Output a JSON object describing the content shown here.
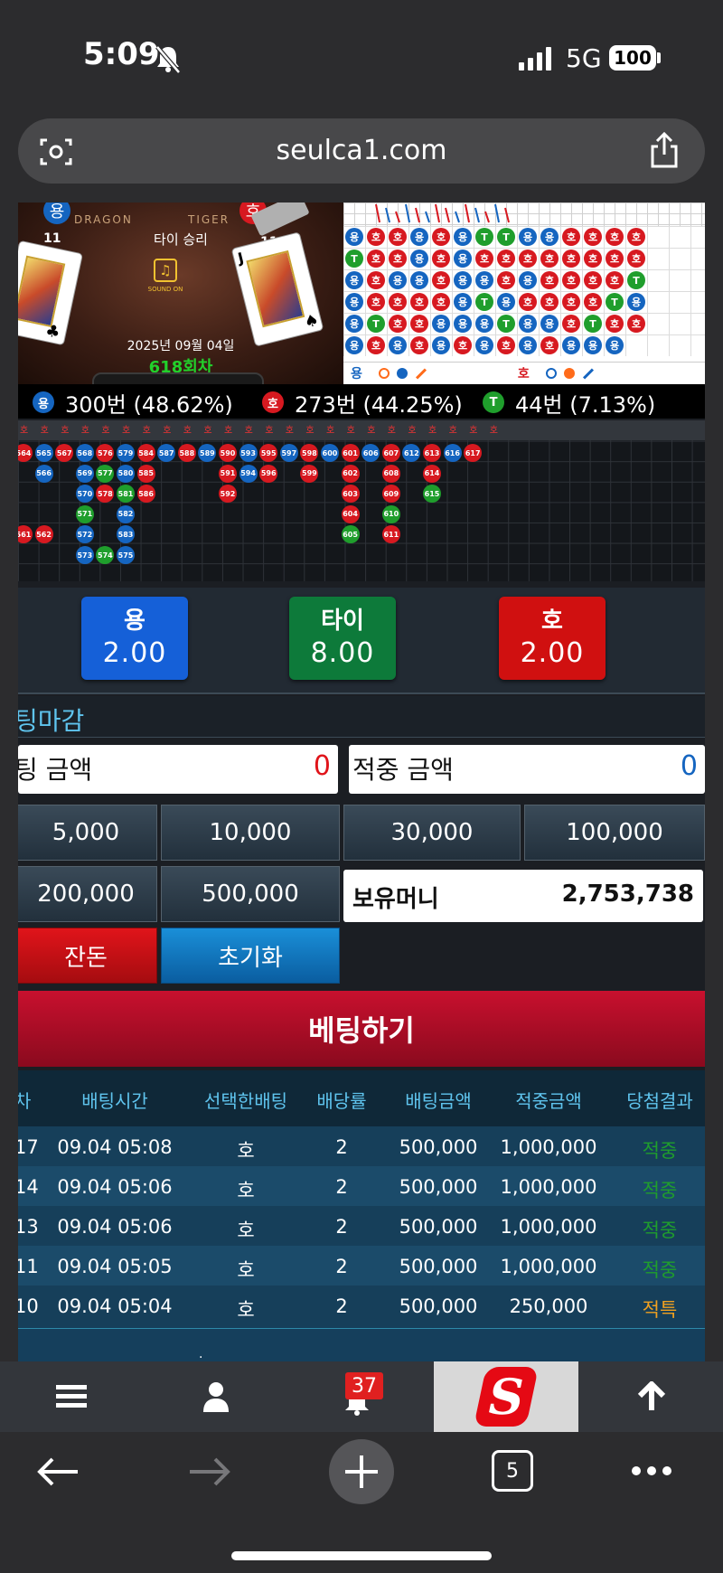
{
  "status_bar": {
    "time": "5:09",
    "network": "5G",
    "battery": "100"
  },
  "url_bar": {
    "domain": "seulca1.com"
  },
  "game": {
    "dragon_label": "DRAGON",
    "tiger_label": "TIGER",
    "dragon_short": "용",
    "tiger_short": "호",
    "result_text": "타이 승리",
    "left_card_value": "11",
    "right_card_value": "11",
    "sound_label": "SOUND ON",
    "date_text": "2025년 09월 04일",
    "round_text": "618회차"
  },
  "road_grid": {
    "rows": [
      [
        "용",
        "호",
        "호",
        "용",
        "호",
        "용",
        "T",
        "T",
        "용",
        "용",
        "호",
        "호",
        "호",
        "호"
      ],
      [
        "T",
        "호",
        "호",
        "용",
        "호",
        "용",
        "호",
        "호",
        "호",
        "호",
        "호",
        "호",
        "호",
        "호"
      ],
      [
        "용",
        "호",
        "용",
        "용",
        "호",
        "용",
        "용",
        "호",
        "용",
        "호",
        "호",
        "호",
        "호",
        "T"
      ],
      [
        "용",
        "호",
        "호",
        "호",
        "호",
        "용",
        "T",
        "용",
        "호",
        "호",
        "호",
        "호",
        "T",
        "용"
      ],
      [
        "용",
        "T",
        "호",
        "호",
        "용",
        "용",
        "용",
        "T",
        "용",
        "용",
        "호",
        "T",
        "호",
        "호"
      ],
      [
        "용",
        "호",
        "용",
        "호",
        "용",
        "호",
        "용",
        "호",
        "용",
        "호",
        "용",
        "용",
        "용",
        ""
      ]
    ],
    "legend_dragon": "용",
    "legend_tiger": "호"
  },
  "stats": {
    "dragon_icon": "용",
    "dragon_text": "300번 (48.62%)",
    "tiger_icon": "호",
    "tiger_text": "273번 (44.25%)",
    "tie_icon": "T",
    "tie_text": "44번 (7.13%)"
  },
  "round_history": {
    "header": [
      "호",
      "호",
      "호",
      "호",
      "호",
      "호",
      "호",
      "호",
      "호",
      "호",
      "호",
      "호",
      "호",
      "호",
      "호",
      "호",
      "호",
      "호",
      "호",
      "호",
      "호",
      "호",
      "호",
      "호"
    ],
    "columns": [
      [
        {
          "n": "564",
          "c": "red"
        },
        {
          "n": "",
          "c": ""
        },
        {
          "n": "",
          "c": ""
        },
        {
          "n": "",
          "c": ""
        },
        {
          "n": "561",
          "c": "red"
        }
      ],
      [
        {
          "n": "565",
          "c": "blue"
        },
        {
          "n": "566",
          "c": "blue"
        },
        {
          "n": "",
          "c": ""
        },
        {
          "n": "",
          "c": ""
        },
        {
          "n": "562",
          "c": "red"
        }
      ],
      [
        {
          "n": "567",
          "c": "red"
        }
      ],
      [
        {
          "n": "568",
          "c": "blue"
        },
        {
          "n": "569",
          "c": "blue"
        },
        {
          "n": "570",
          "c": "blue"
        },
        {
          "n": "571",
          "c": "green"
        },
        {
          "n": "572",
          "c": "blue"
        },
        {
          "n": "573",
          "c": "blue"
        }
      ],
      [
        {
          "n": "576",
          "c": "red"
        },
        {
          "n": "577",
          "c": "green"
        },
        {
          "n": "578",
          "c": "red"
        },
        {
          "n": "",
          "c": ""
        },
        {
          "n": "",
          "c": ""
        },
        {
          "n": "574",
          "c": "green"
        }
      ],
      [
        {
          "n": "579",
          "c": "blue"
        },
        {
          "n": "580",
          "c": "blue"
        },
        {
          "n": "581",
          "c": "green"
        },
        {
          "n": "582",
          "c": "blue"
        },
        {
          "n": "583",
          "c": "blue"
        },
        {
          "n": "575",
          "c": "blue"
        }
      ],
      [
        {
          "n": "584",
          "c": "red"
        },
        {
          "n": "585",
          "c": "red"
        },
        {
          "n": "586",
          "c": "red"
        }
      ],
      [
        {
          "n": "587",
          "c": "blue"
        }
      ],
      [
        {
          "n": "588",
          "c": "red"
        }
      ],
      [
        {
          "n": "589",
          "c": "blue"
        }
      ],
      [
        {
          "n": "590",
          "c": "red"
        },
        {
          "n": "591",
          "c": "red"
        },
        {
          "n": "592",
          "c": "red"
        }
      ],
      [
        {
          "n": "593",
          "c": "blue"
        },
        {
          "n": "594",
          "c": "blue"
        }
      ],
      [
        {
          "n": "595",
          "c": "red"
        },
        {
          "n": "596",
          "c": "red"
        }
      ],
      [
        {
          "n": "597",
          "c": "blue"
        }
      ],
      [
        {
          "n": "598",
          "c": "red"
        },
        {
          "n": "599",
          "c": "red"
        }
      ],
      [
        {
          "n": "600",
          "c": "blue"
        }
      ],
      [
        {
          "n": "601",
          "c": "red"
        },
        {
          "n": "602",
          "c": "red"
        },
        {
          "n": "603",
          "c": "red"
        },
        {
          "n": "604",
          "c": "red"
        },
        {
          "n": "605",
          "c": "green"
        }
      ],
      [
        {
          "n": "606",
          "c": "blue"
        }
      ],
      [
        {
          "n": "607",
          "c": "red"
        },
        {
          "n": "608",
          "c": "red"
        },
        {
          "n": "609",
          "c": "red"
        },
        {
          "n": "610",
          "c": "green"
        },
        {
          "n": "611",
          "c": "red"
        }
      ],
      [
        {
          "n": "612",
          "c": "blue"
        }
      ],
      [
        {
          "n": "613",
          "c": "red"
        },
        {
          "n": "614",
          "c": "red"
        },
        {
          "n": "615",
          "c": "green"
        }
      ],
      [
        {
          "n": "616",
          "c": "blue"
        }
      ],
      [
        {
          "n": "617",
          "c": "red"
        }
      ]
    ]
  },
  "bet_buttons": [
    {
      "label": "용",
      "odds": "2.00",
      "color": "#1560d8"
    },
    {
      "label": "타이",
      "odds": "8.00",
      "color": "#0d7a3a"
    },
    {
      "label": "호",
      "odds": "2.00",
      "color": "#d01010"
    }
  ],
  "betting": {
    "closed_label": "팅마감",
    "bet_amount_label": "팅 금액",
    "bet_amount_value": "0",
    "win_amount_label": "적중 금액",
    "win_amount_value": "0",
    "chips": [
      "5,000",
      "10,000",
      "30,000",
      "100,000",
      "200,000",
      "500,000"
    ],
    "balance_label": "보유머니",
    "balance_value": "2,753,738",
    "change_label": "잔돈",
    "reset_label": "초기화",
    "submit_label": "베팅하기"
  },
  "history": {
    "headers": [
      "차",
      "배팅시간",
      "선택한배팅",
      "배당률",
      "배팅금액",
      "적중금액",
      "당첨결과"
    ],
    "rows": [
      {
        "round": "17",
        "time": "09.04 05:08",
        "choice": "호",
        "odds": "2",
        "bet": "500,000",
        "win": "1,000,000",
        "result": "적중"
      },
      {
        "round": "14",
        "time": "09.04 05:06",
        "choice": "호",
        "odds": "2",
        "bet": "500,000",
        "win": "1,000,000",
        "result": "적중"
      },
      {
        "round": "13",
        "time": "09.04 05:06",
        "choice": "호",
        "odds": "2",
        "bet": "500,000",
        "win": "1,000,000",
        "result": "적중"
      },
      {
        "round": "11",
        "time": "09.04 05:05",
        "choice": "호",
        "odds": "2",
        "bet": "500,000",
        "win": "1,000,000",
        "result": "적중"
      },
      {
        "round": "10",
        "time": "09.04 05:04",
        "choice": "호",
        "odds": "2",
        "bet": "500,000",
        "win": "250,000",
        "result": "적특"
      }
    ]
  },
  "navbar": {
    "badge_count": "37"
  },
  "browser": {
    "tab_count": "5"
  }
}
